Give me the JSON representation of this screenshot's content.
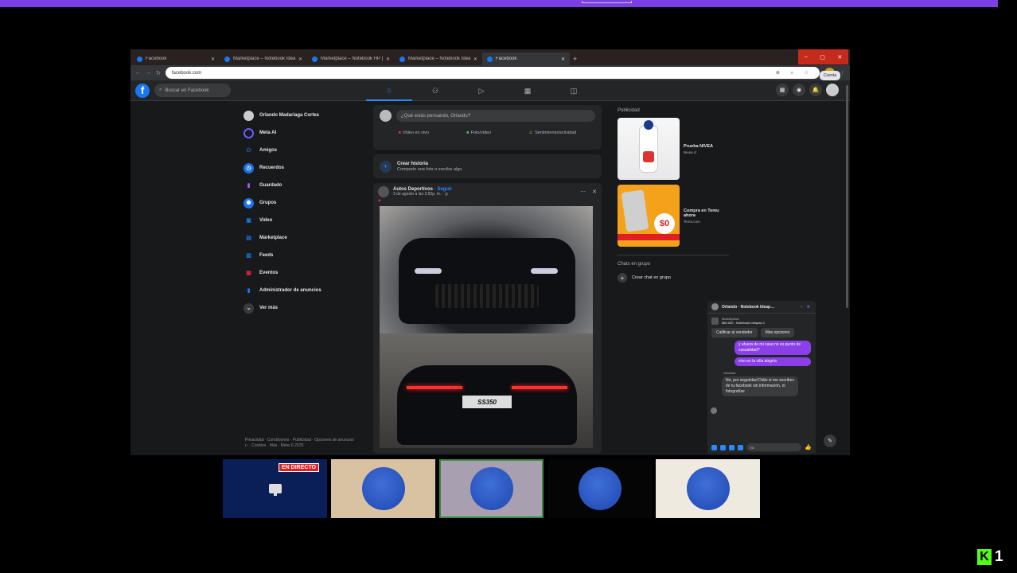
{
  "browser": {
    "tabs": [
      {
        "label": "Facebook",
        "active": false
      },
      {
        "label": "Marketplace – Notebook Ideap…",
        "active": false
      },
      {
        "label": "Marketplace – Notebook HP | …",
        "active": false
      },
      {
        "label": "Marketplace – Notebook Ideap…",
        "active": false
      },
      {
        "label": "Facebook",
        "active": true
      }
    ],
    "new_tab": "+",
    "url": "facebook.com",
    "window_controls": [
      "–",
      "▢",
      "✕"
    ]
  },
  "fb": {
    "logo": "f",
    "search_placeholder": "Buscar en Facebook",
    "nav_tabs": [
      {
        "icon": "home-icon",
        "glyph": "⌂",
        "active": true
      },
      {
        "icon": "friends-icon",
        "glyph": "⚇",
        "active": false
      },
      {
        "icon": "video-icon",
        "glyph": "▷",
        "active": false
      },
      {
        "icon": "marketplace-icon",
        "glyph": "▦",
        "active": false
      },
      {
        "icon": "gaming-icon",
        "glyph": "◫",
        "active": false
      }
    ],
    "tooltip": "Cuenta"
  },
  "sidebar": {
    "items": [
      {
        "label": "Orlando Madariaga Cortes",
        "icon": "avatar",
        "color": "#cccccc"
      },
      {
        "label": "Meta AI",
        "icon": "meta-ai-icon",
        "color": "#6b5bff"
      },
      {
        "label": "Amigos",
        "icon": "friends-icon",
        "color": "#1b74e4"
      },
      {
        "label": "Recuerdos",
        "icon": "memories-icon",
        "color": "#1b74e4"
      },
      {
        "label": "Guardado",
        "icon": "saved-icon",
        "color": "#a855f7"
      },
      {
        "label": "Grupos",
        "icon": "groups-icon",
        "color": "#1b74e4"
      },
      {
        "label": "Video",
        "icon": "video-icon",
        "color": "#1b74e4"
      },
      {
        "label": "Marketplace",
        "icon": "marketplace-icon",
        "color": "#1b74e4"
      },
      {
        "label": "Feeds",
        "icon": "feeds-icon",
        "color": "#1b74e4"
      },
      {
        "label": "Eventos",
        "icon": "events-icon",
        "color": "#e41e3f"
      },
      {
        "label": "Administrador de anuncios",
        "icon": "ads-manager-icon",
        "color": "#1b74e4"
      },
      {
        "label": "Ver más",
        "icon": "chevron-down-icon",
        "color": "#3a3b3c"
      }
    ],
    "footer": "Privacidad · Condiciones · Publicidad · Opciones de anuncios ▷ · Cookies · Más · Meta © 2025"
  },
  "composer": {
    "placeholder": "¿Qué estás pensando, Orlando?",
    "actions": [
      "Video en vivo",
      "Foto/video",
      "Sentimiento/actividad"
    ]
  },
  "story": {
    "title": "Crear historia",
    "subtitle": "Comparte una foto o escribe algo."
  },
  "post": {
    "author": "Autos Deportivos",
    "follow": " · Seguir",
    "meta": "3 de agosto a las 3:50p. m. · ◎",
    "plate": "SS350"
  },
  "right": {
    "ads_heading": "Publicidad",
    "ads": [
      {
        "title": "Prueba NIVEA",
        "source": "Nivea.cl"
      },
      {
        "title": "Compra en Temu ahora",
        "source": "Temu.com"
      }
    ],
    "group_chats_heading": "Chats en grupo",
    "create_group": "Crear chat en grupo"
  },
  "chat": {
    "title": "Orlando · Notebook Ideap…",
    "marketplace_label": "Marketplace",
    "product": "$50.000 · Notebook Ideapad 1",
    "buttons": [
      "Calificar al vendedor",
      "Más opciones"
    ],
    "messages": [
      {
        "from": "me",
        "text": "y afuera de mi casa no es punto de casualidad?"
      },
      {
        "from": "me",
        "text": "vivo en la villa alegría"
      },
      {
        "from": "them",
        "text": "No, por seguridad Diálo si me escribes de tu facebook sin información, ni fotografías"
      }
    ],
    "sender_name": "Vanessa",
    "input_placeholder": "Aa"
  },
  "stream": {
    "live_badge": "EN DIRECTO",
    "tiles": 5
  },
  "kick": {
    "logo": "K",
    "viewers": "1"
  }
}
